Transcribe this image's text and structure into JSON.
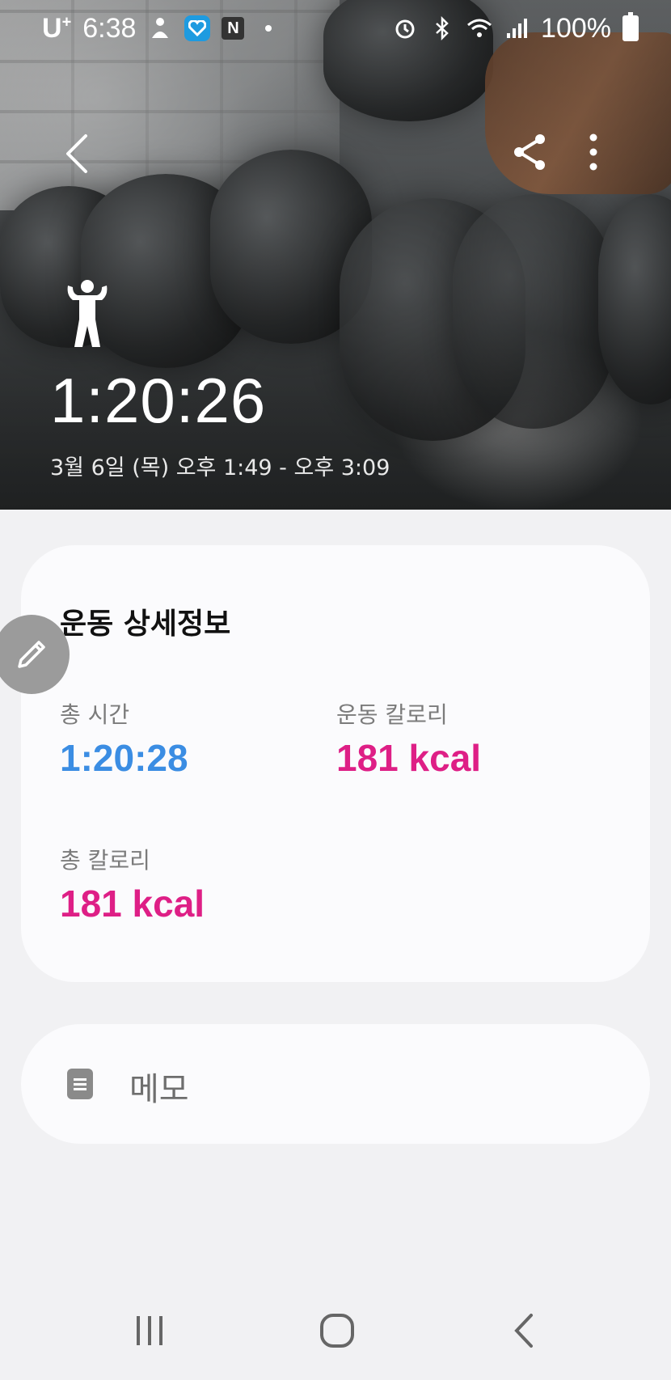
{
  "status_bar": {
    "carrier": "U",
    "carrier_sup": "+",
    "time": "6:38",
    "battery": "100%",
    "icons": [
      "person-icon",
      "heart-app-icon",
      "n-app-icon",
      "dot-icon",
      "alarm-icon",
      "bluetooth-icon",
      "wifi-icon",
      "signal-icon",
      "battery-icon"
    ]
  },
  "header": {
    "back_icon": "chevron-left-icon",
    "share_icon": "share-icon",
    "more_icon": "more-vertical-icon",
    "exercise_icon": "strength-person-icon"
  },
  "workout": {
    "duration": "1:20:26",
    "date_range": "3월 6일 (목) 오후 1:49 - 오후 3:09"
  },
  "details": {
    "title": "운동 상세정보",
    "total_time_label": "총 시간",
    "total_time_value": "1:20:28",
    "exercise_calories_label": "운동 칼로리",
    "exercise_calories_value": "181 kcal",
    "total_calories_label": "총 칼로리",
    "total_calories_value": "181 kcal"
  },
  "memo": {
    "label": "메모",
    "icon": "memo-icon"
  },
  "colors": {
    "accent_blue": "#3b8de3",
    "accent_pink": "#de1f86",
    "background": "#f1f1f3",
    "card": "#fbfbfd"
  },
  "nav": {
    "recent_icon": "recent-apps-icon",
    "home_icon": "home-icon",
    "back_icon": "back-icon"
  }
}
